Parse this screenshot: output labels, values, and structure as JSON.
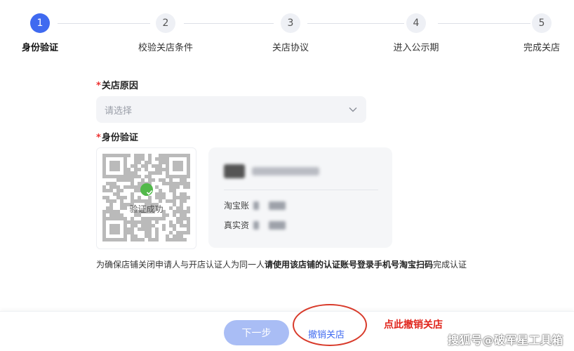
{
  "stepper": {
    "steps": [
      {
        "num": "1",
        "label": "身份验证",
        "active": true
      },
      {
        "num": "2",
        "label": "校验关店条件",
        "active": false
      },
      {
        "num": "3",
        "label": "关店协议",
        "active": false
      },
      {
        "num": "4",
        "label": "进入公示期",
        "active": false
      },
      {
        "num": "5",
        "label": "完成关店",
        "active": false
      }
    ]
  },
  "form": {
    "reason": {
      "required_mark": "*",
      "label": "关店原因",
      "placeholder": "请选择"
    },
    "identity": {
      "required_mark": "*",
      "label": "身份验证",
      "qr_status": "验证成功",
      "account_label": "淘宝账",
      "real_label": "真实资"
    },
    "note_prefix": "为确保店铺关闭申请人与开店认证人为同一人",
    "note_bold": "请使用该店铺的认证账号登录手机号淘宝扫码",
    "note_suffix": "完成认证"
  },
  "footer": {
    "next_label": "下一步",
    "cancel_label": "撤销关店"
  },
  "annotation": {
    "text": "点此撤销关店"
  },
  "watermark": {
    "text": "搜狐号@破军星工具箱"
  },
  "colors": {
    "primary": "#3f6af0",
    "next_disabled": "#a9bdf5",
    "success": "#52b94a",
    "annotation_red": "#e0251c",
    "required": "#ee3333"
  }
}
